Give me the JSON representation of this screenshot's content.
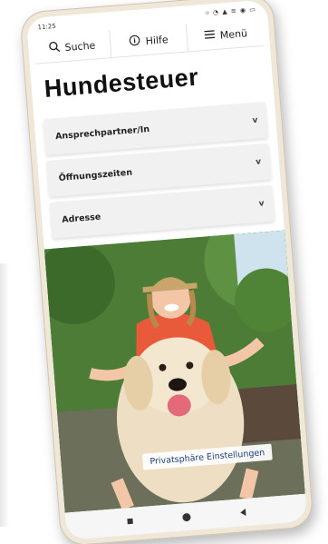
{
  "status_bar": {
    "time": "11:25",
    "icons": "⌾ ◔ ▲ ≋ ◉ ▭"
  },
  "topnav": {
    "search_label": "Suche",
    "help_label": "Hilfe",
    "menu_label": "Menü"
  },
  "page": {
    "title": "Hundesteuer"
  },
  "accordion": {
    "items": [
      {
        "label": "Ansprechpartner/In",
        "chevron": "v"
      },
      {
        "label": "Öffnungszeiten",
        "chevron": "v"
      },
      {
        "label": "Adresse",
        "chevron": "v"
      }
    ]
  },
  "hero": {
    "privacy_label": "Privatsphäre Einstellungen"
  },
  "icons": {
    "search": "search-icon",
    "help": "help-icon",
    "menu": "hamburger-icon",
    "back": "back-icon",
    "home": "home-icon",
    "recents": "recents-icon"
  },
  "colors": {
    "frame": "#efe7d7",
    "accordion_bg": "#f1f1f1",
    "privacy_text": "#1d3e7a"
  }
}
